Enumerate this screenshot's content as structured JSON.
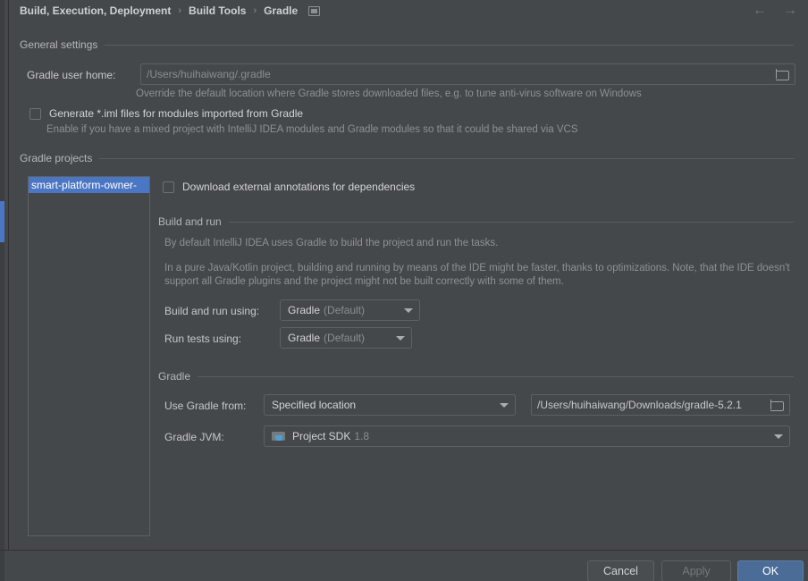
{
  "breadcrumb": {
    "items": [
      "Build, Execution, Deployment",
      "Build Tools",
      "Gradle"
    ],
    "separator": "›",
    "reset_icon": "reset-settings-icon"
  },
  "nav": {
    "back_icon": "←",
    "forward_icon": "→"
  },
  "general_settings": {
    "group_title": "General settings",
    "gradle_user_home": {
      "label": "Gradle user home:",
      "value": "",
      "placeholder": "/Users/huihaiwang/.gradle",
      "browse_icon": "folder-icon",
      "hint": "Override the default location where Gradle stores downloaded files, e.g. to tune anti-virus software on Windows"
    },
    "generate_iml": {
      "label": "Generate *.iml files for modules imported from Gradle",
      "checked": false,
      "hint": "Enable if you have a mixed project with IntelliJ IDEA modules and Gradle modules so that it could be shared via VCS"
    }
  },
  "gradle_projects": {
    "group_title": "Gradle projects",
    "items": [
      {
        "label": "smart-platform-owner-",
        "selected": true
      }
    ]
  },
  "download_annotations": {
    "label": "Download external annotations for dependencies",
    "checked": false
  },
  "build_and_run": {
    "group_title": "Build and run",
    "paragraph_1": "By default IntelliJ IDEA uses Gradle to build the project and run the tasks.",
    "paragraph_2_line_1": "In a pure Java/Kotlin project, building and running by means of the IDE might be faster, thanks to optimizations. Note, that the IDE doesn't",
    "paragraph_2_line_2": "support all Gradle plugins and the project might not be built correctly with some of them.",
    "build_using": {
      "label": "Build and run using:",
      "value": "Gradle",
      "value_suffix": "(Default)"
    },
    "test_using": {
      "label": "Run tests using:",
      "value": "Gradle",
      "value_suffix": "(Default)"
    }
  },
  "gradle_section": {
    "group_title": "Gradle",
    "use_gradle_from": {
      "label": "Use Gradle from:",
      "value": "Specified location"
    },
    "gradle_location": {
      "value": "/Users/huihaiwang/Downloads/gradle-5.2.1",
      "browse_icon": "folder-icon"
    },
    "gradle_jvm": {
      "label": "Gradle JVM:",
      "icon": "jdk-icon",
      "value": "Project SDK",
      "value_suffix": "1.8"
    }
  },
  "footer": {
    "cancel_label": "Cancel",
    "apply_label": "Apply",
    "ok_label": "OK"
  },
  "colors": {
    "background": "#45484a",
    "accent_blue": "#4a76c4",
    "primary_button": "#4a6c96",
    "text": "#c6c9cb",
    "muted_text": "#8d9194"
  }
}
